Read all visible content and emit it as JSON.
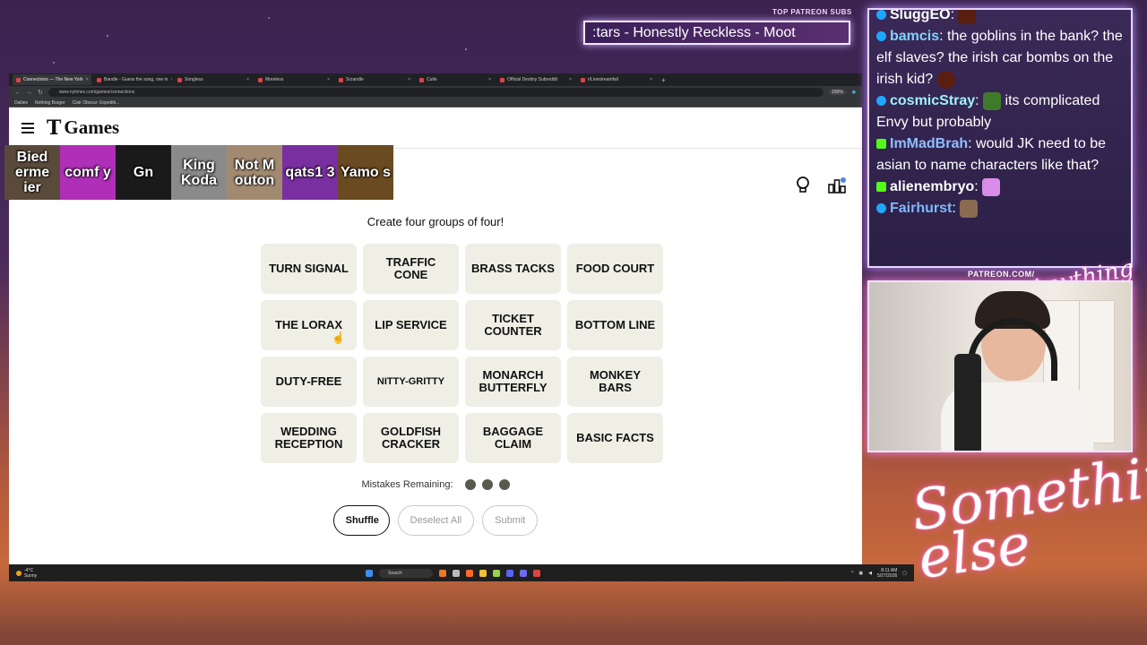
{
  "overlay": {
    "patreon_subs_label": "TOP PATREON SUBS",
    "now_playing": ":tars - Honestly Reckless - Moot",
    "patreon_site": "PATREON.COM/",
    "anything_else": "Anything else",
    "something_else": "Something else"
  },
  "browser": {
    "tabs": [
      {
        "label": "Connections — The New York",
        "active": true
      },
      {
        "label": "Bandle - Guess the song, one in"
      },
      {
        "label": "Songless"
      },
      {
        "label": "Moreless"
      },
      {
        "label": "Scrandle"
      },
      {
        "label": "Cutle"
      },
      {
        "label": "Official Destiny Subreddit"
      },
      {
        "label": "r/Livestreamfail"
      }
    ],
    "url": "www.nytimes.com/games/connections",
    "zoom": "150%",
    "bookmarks": [
      "Dailies",
      "Nothing Burger",
      "Clair Obscur: Expediti..."
    ]
  },
  "nyt": {
    "logo_text": "Games",
    "logo_t": "T"
  },
  "viewers": [
    {
      "name": "Bied erme ier",
      "color": "#5a4a3a"
    },
    {
      "name": "comf y",
      "color": "#b02fb8"
    },
    {
      "name": "Gn",
      "color": "#1a1a1a"
    },
    {
      "name": "King Koda",
      "color": "#8a8a8a"
    },
    {
      "name": "Not M outon",
      "color": "#a28a70"
    },
    {
      "name": "qats1 3",
      "color": "#7a2fa0"
    },
    {
      "name": "Yamo s",
      "color": "#6a4a20"
    }
  ],
  "game": {
    "instructions": "Create four groups of four!",
    "tiles": [
      "TURN SIGNAL",
      "TRAFFIC CONE",
      "BRASS TACKS",
      "FOOD COURT",
      "THE LORAX",
      "LIP SERVICE",
      "TICKET COUNTER",
      "BOTTOM LINE",
      "DUTY-FREE",
      "NITTY-GRITTY",
      "MONARCH BUTTERFLY",
      "MONKEY BARS",
      "WEDDING RECEPTION",
      "GOLDFISH CRACKER",
      "BAGGAGE CLAIM",
      "BASIC FACTS"
    ],
    "mistakes_label": "Mistakes Remaining:",
    "mistakes_remaining": 3,
    "shuffle_label": "Shuffle",
    "deselect_label": "Deselect All",
    "submit_label": "Submit"
  },
  "taskbar": {
    "weather_temp": "-4°C",
    "weather_desc": "Sunny",
    "search_placeholder": "Search",
    "time": "8:11 AM",
    "date": "5/27/2026"
  },
  "chat": [
    {
      "user": "SluggEO",
      "text": "",
      "color": "#ffffff",
      "badge_color": "#1ea7ff"
    },
    {
      "user": "bamcis",
      "text": "the goblins in the bank? the elf slaves? the irish car bombs on the irish kid?",
      "color": "#7fd3ff",
      "badge_color": "#1ea7ff"
    },
    {
      "user": "cosmicStray",
      "text": "its complicated Envy but probably",
      "color": "#a0f0ff",
      "badge_color": "#1ea7ff"
    },
    {
      "user": "ImMadBrah",
      "text": "would JK need to be asian to name characters like that?",
      "color": "#8fbfff",
      "badge_color": "#53fc18"
    },
    {
      "user": "alienembryo",
      "text": "",
      "color": "#ffffff",
      "badge_color": "#53fc18"
    },
    {
      "user": "Fairhurst",
      "text": "",
      "color": "#7fb8ff",
      "badge_color": "#1ea7ff"
    }
  ],
  "colors": {
    "tile_bg": "#efefe6",
    "mistake_dot": "#5a594e",
    "chat_border": "#e5d7ff"
  }
}
